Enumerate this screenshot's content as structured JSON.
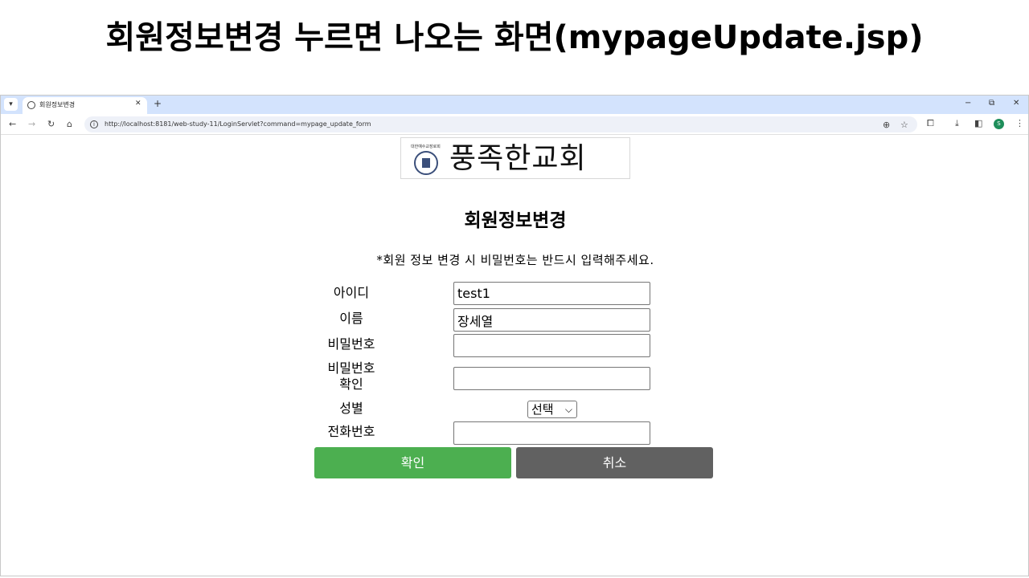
{
  "slide": {
    "title": "회원정보변경 누르면 나오는 화면(mypageUpdate.jsp)"
  },
  "browser": {
    "tab_title": "회원정보변경",
    "url": "http://localhost:8181/web-study-11/LoginServlet?command=mypage_update_form",
    "profile_initial": "S",
    "icons": {
      "tab_list": "▾",
      "tab_close": "✕",
      "new_tab": "+",
      "minimize": "−",
      "restore": "⧉",
      "close": "✕",
      "back": "←",
      "forward": "→",
      "reload": "↻",
      "home": "⌂",
      "info": "i",
      "zoom": "⊕",
      "bookmark": "☆",
      "extensions": "⧠",
      "download": "⤓",
      "side_panel": "◧",
      "menu": "⋮"
    }
  },
  "logo": {
    "denomination": "대한예수교장로회",
    "church_name": "풍족한교회"
  },
  "form": {
    "title": "회원정보변경",
    "notice": "*회원 정보 변경 시 비밀번호는 반드시 입력해주세요.",
    "id_label": "아이디",
    "id_value": "test1",
    "name_label": "이름",
    "name_value": "장세열",
    "password_label": "비밀번호",
    "password_value": "",
    "password_confirm_label_1": "비밀번호",
    "password_confirm_label_2": "확인",
    "password_confirm_value": "",
    "gender_label": "성별",
    "gender_selected": "선택",
    "gender_chevron": "⌵",
    "phone_label": "전화번호",
    "phone_value": "",
    "confirm_button": "확인",
    "cancel_button": "취소"
  },
  "colors": {
    "confirm": "#4caf50",
    "cancel": "#616161",
    "tabstrip": "#d3e3fd"
  }
}
